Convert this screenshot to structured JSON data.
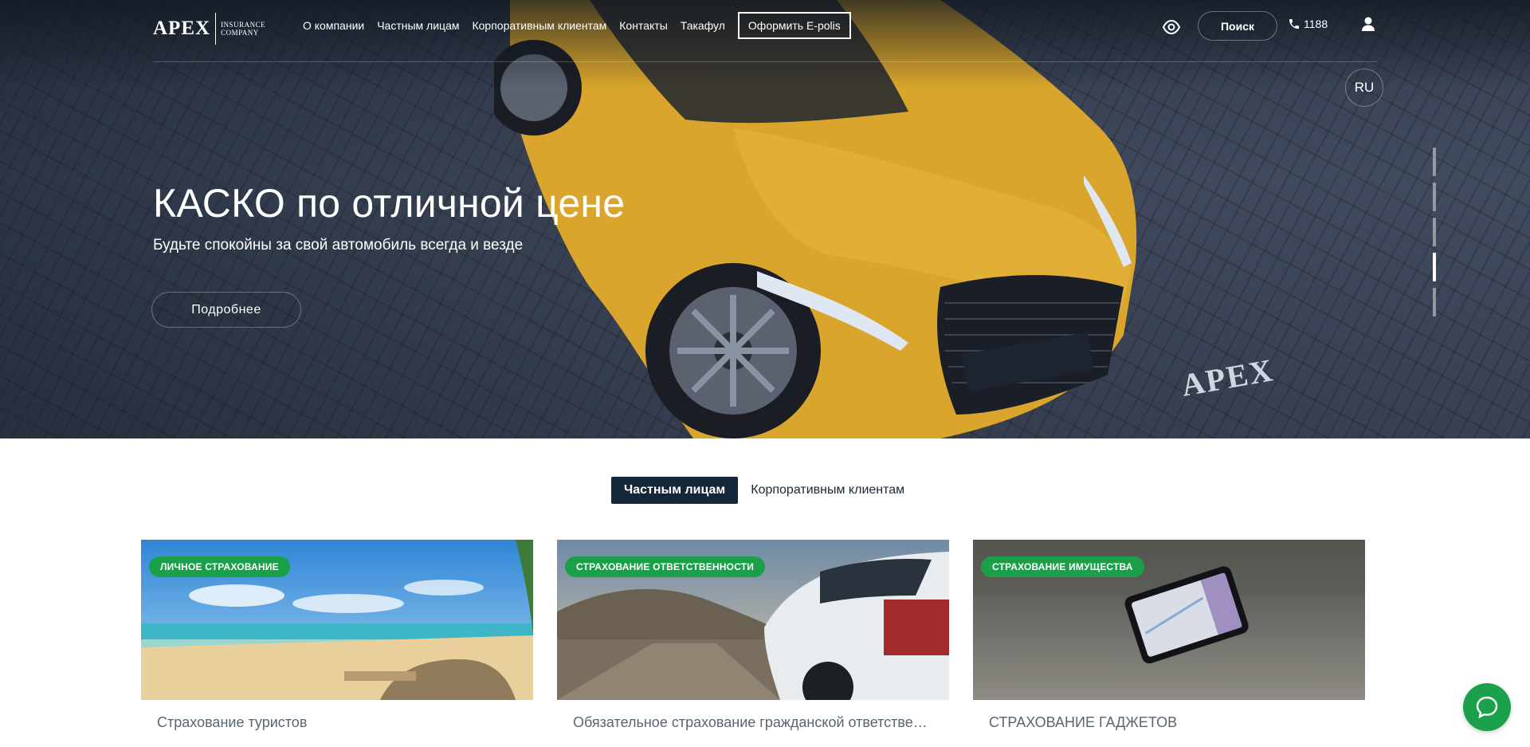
{
  "header": {
    "logo_word": "APEX",
    "logo_sub_line1": "INSURANCE",
    "logo_sub_line2": "COMPANY",
    "nav": [
      {
        "label": "О компании"
      },
      {
        "label": "Частным лицам"
      },
      {
        "label": "Корпоративным клиентам"
      },
      {
        "label": "Контакты"
      },
      {
        "label": "Такафул"
      }
    ],
    "cta_label": "Оформить E-polis",
    "search_label": "Поиск",
    "phone": "1188",
    "language": "RU"
  },
  "hero": {
    "title": "КАСКО по отличной цене",
    "subtitle": "Будьте спокойны за свой автомобиль всегда и везде",
    "more_label": "Подробнее",
    "plate_text": "APEX",
    "slides_total": 5,
    "active_slide": 4
  },
  "tabs": [
    {
      "label": "Частным лицам",
      "active": true
    },
    {
      "label": "Корпоративным клиентам",
      "active": false
    }
  ],
  "cards": [
    {
      "badge": "ЛИЧНОЕ СТРАХОВАНИЕ",
      "title": "Страхование туристов"
    },
    {
      "badge": "СТРАХОВАНИЕ ОТВЕТСТВЕННОСТИ",
      "title": "Обязательное страхование гражданской ответственности владельцев автотранспортных средств"
    },
    {
      "badge": "СТРАХОВАНИЕ ИМУЩЕСТВА",
      "title": "СТРАХОВАНИЕ ГАДЖЕТОВ"
    }
  ],
  "colors": {
    "accent_green": "#1aa049",
    "tab_active": "#14263a",
    "car_yellow": "#d9a52c"
  },
  "icons": {
    "accessibility": "eye-icon",
    "phone": "phone-icon",
    "user": "user-icon",
    "chat": "chat-icon"
  }
}
